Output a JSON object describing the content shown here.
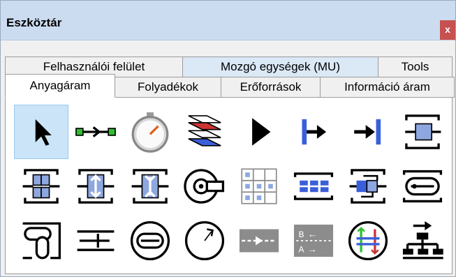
{
  "window": {
    "title": "Eszköztár",
    "close_glyph": "x"
  },
  "tabs_back": [
    {
      "label": "Felhasználói felület"
    },
    {
      "label": "Mozgó egységek (MU)"
    },
    {
      "label": "Tools"
    }
  ],
  "tabs_front": [
    {
      "label": "Anyagáram",
      "selected": true
    },
    {
      "label": "Folyadékok"
    },
    {
      "label": "Erőforrások"
    },
    {
      "label": "Információ áram"
    }
  ],
  "tools": [
    "pointer-icon",
    "connector-icon",
    "stopwatch-icon",
    "layers-icon",
    "play-icon",
    "source-icon",
    "drain-icon",
    "single-proc-icon",
    "parallel-proc-icon",
    "assembly-icon",
    "dismantle-icon",
    "turntable-icon",
    "store-icon",
    "buffer-icon",
    "sorter-icon",
    "line-icon",
    "angular-converter-icon",
    "track-icon",
    "turnplate-icon",
    "cycle-icon",
    "flow-control-icon",
    "bidirectional-icon",
    "crossroads-icon",
    "hierarchy-icon"
  ],
  "colors": {
    "selection": "#cce4f7",
    "accent_blue": "#3a5fd9",
    "green": "#2fbf2f"
  }
}
